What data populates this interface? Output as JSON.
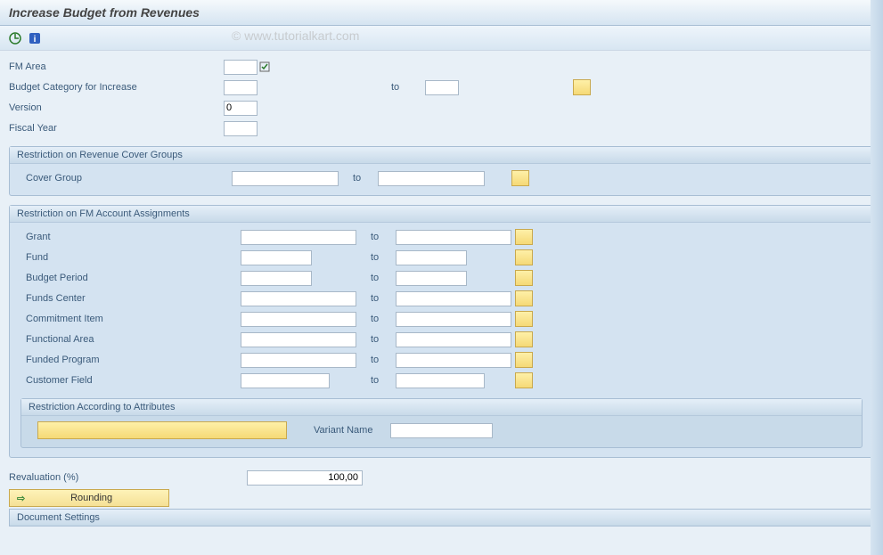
{
  "title": "Increase Budget from Revenues",
  "watermark": "© www.tutorialkart.com",
  "header": {
    "fm_area": {
      "label": "FM Area",
      "value": ""
    },
    "budget_category": {
      "label": "Budget Category for Increase",
      "value": "",
      "to_label": "to",
      "to_value": ""
    },
    "version": {
      "label": "Version",
      "value": "0"
    },
    "fiscal_year": {
      "label": "Fiscal Year",
      "value": ""
    }
  },
  "group1": {
    "title": "Restriction on Revenue Cover Groups",
    "cover_group": {
      "label": "Cover Group",
      "from": "",
      "to_label": "to",
      "to": ""
    }
  },
  "group2": {
    "title": "Restriction on FM Account Assignments",
    "rows": [
      {
        "label": "Grant",
        "from": "",
        "to_label": "to",
        "to": ""
      },
      {
        "label": "Fund",
        "from": "",
        "to_label": "to",
        "to": ""
      },
      {
        "label": "Budget Period",
        "from": "",
        "to_label": "to",
        "to": ""
      },
      {
        "label": "Funds Center",
        "from": "",
        "to_label": "to",
        "to": ""
      },
      {
        "label": "Commitment Item",
        "from": "",
        "to_label": "to",
        "to": ""
      },
      {
        "label": "Functional Area",
        "from": "",
        "to_label": "to",
        "to": ""
      },
      {
        "label": "Funded Program",
        "from": "",
        "to_label": "to",
        "to": ""
      },
      {
        "label": "Customer Field",
        "from": "",
        "to_label": "to",
        "to": ""
      }
    ],
    "nested": {
      "title": "Restriction According to Attributes",
      "variant_label": "Variant Name",
      "variant_value": ""
    }
  },
  "revaluation": {
    "label": "Revaluation (%)",
    "value": "100,00"
  },
  "rounding_label": "Rounding",
  "doc_settings_label": "Document Settings"
}
